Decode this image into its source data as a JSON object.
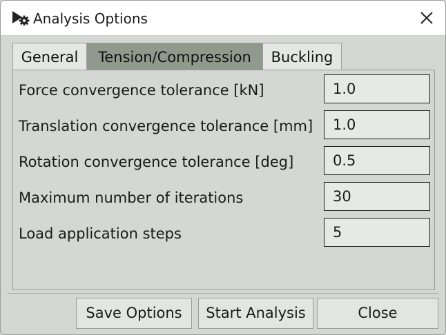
{
  "window": {
    "title": "Analysis Options"
  },
  "tabs": [
    {
      "label": "General",
      "active": false
    },
    {
      "label": "Tension/Compression",
      "active": true
    },
    {
      "label": "Buckling",
      "active": false
    }
  ],
  "fields": [
    {
      "label": "Force convergence tolerance [kN]",
      "value": "1.0"
    },
    {
      "label": "Translation convergence tolerance [mm]",
      "value": "1.0"
    },
    {
      "label": "Rotation convergence tolerance [deg]",
      "value": "0.5"
    },
    {
      "label": "Maximum number of iterations",
      "value": "30"
    },
    {
      "label": "Load application steps",
      "value": "5"
    }
  ],
  "buttons": {
    "save": "Save Options",
    "start": "Start Analysis",
    "close": "Close"
  },
  "icons": {
    "app": "play-gear-icon",
    "close": "close-icon"
  },
  "colors": {
    "active_tab": "#8f9a8c",
    "background": "#d4d7d3"
  }
}
